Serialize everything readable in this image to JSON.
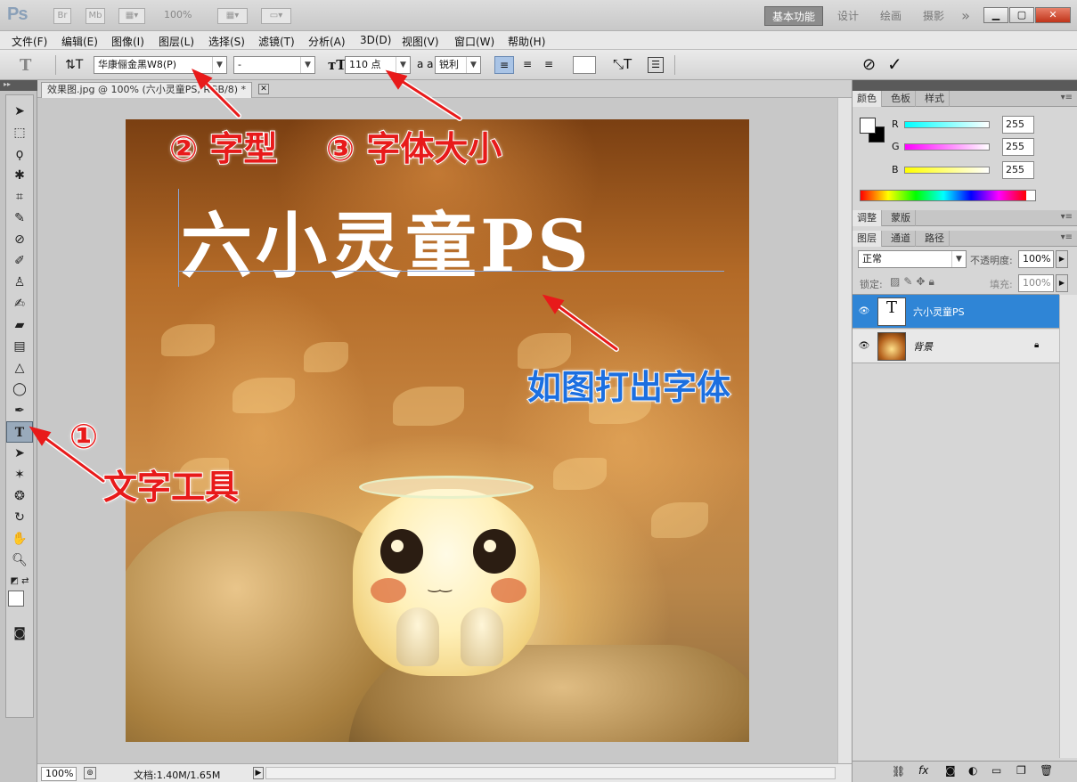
{
  "app": {
    "logo": "Ps",
    "bridge_label": "Br",
    "minibridge_label": "Mb",
    "zoom_display": "100%",
    "workspaces": [
      "基本功能",
      "设计",
      "绘画",
      "摄影"
    ],
    "more_glyph": "»"
  },
  "menu": [
    "文件(F)",
    "编辑(E)",
    "图像(I)",
    "图层(L)",
    "选择(S)",
    "滤镜(T)",
    "分析(A)",
    "3D(D)",
    "视图(V)",
    "窗口(W)",
    "帮助(H)"
  ],
  "options": {
    "tool_glyph": "T",
    "font_family": "华康俪金黑W8(P)",
    "font_style": "-",
    "font_size": "110 点",
    "aa_label": "a a",
    "antialias": "锐利",
    "cancel_glyph": "⊘",
    "commit_glyph": "✓"
  },
  "document": {
    "tab_title": "效果图.jpg @ 100% (六小灵童PS, RGB/8) *",
    "canvas_text": "六小灵童PS",
    "zoom": "100%",
    "doc_info": "文档:1.40M/1.65M"
  },
  "annotations": {
    "font_type": "② 字型",
    "font_size": "③ 字体大小",
    "type_out": "如图打出字体",
    "step1": "①",
    "text_tool": "文字工具"
  },
  "panels": {
    "color_tabs": [
      "颜色",
      "色板",
      "样式"
    ],
    "color": {
      "channels": [
        {
          "label": "R",
          "value": "255"
        },
        {
          "label": "G",
          "value": "255"
        },
        {
          "label": "B",
          "value": "255"
        }
      ]
    },
    "adjust_tabs": [
      "调整",
      "蒙版"
    ],
    "layers_tabs": [
      "图层",
      "通道",
      "路径"
    ],
    "blend_mode": "正常",
    "opacity_label": "不透明度:",
    "opacity_value": "100%",
    "lock_label": "锁定:",
    "fill_label": "填充:",
    "fill_value": "100%",
    "layers": [
      {
        "name": "六小灵童PS",
        "thumb": "T",
        "selected": true
      },
      {
        "name": "背景",
        "thumb": "",
        "selected": false
      }
    ]
  },
  "colors": {
    "accent": "#2f85d6",
    "annotation_red": "#e81a1a",
    "annotation_blue": "#1c6fe0"
  }
}
